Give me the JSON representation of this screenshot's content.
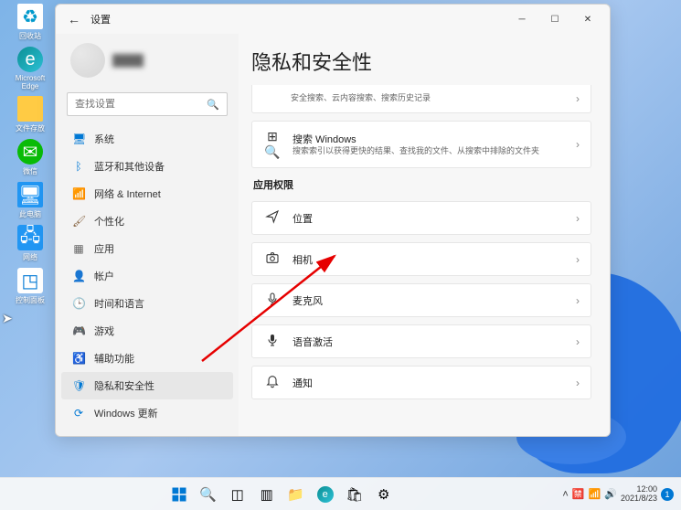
{
  "desktop": {
    "icons": [
      {
        "label": "回收站",
        "name": "recycle-bin"
      },
      {
        "label": "Microsoft Edge",
        "name": "edge"
      },
      {
        "label": "文件存放",
        "name": "folder-files"
      },
      {
        "label": "微信",
        "name": "wechat"
      },
      {
        "label": "此电脑",
        "name": "this-pc"
      },
      {
        "label": "网络",
        "name": "network"
      },
      {
        "label": "控制面板",
        "name": "control-panel"
      }
    ]
  },
  "window": {
    "title": "设置",
    "search_placeholder": "查找设置",
    "nav": [
      {
        "label": "系统",
        "icon": "🖥"
      },
      {
        "label": "蓝牙和其他设备",
        "icon": "ᛒ"
      },
      {
        "label": "网络 & Internet",
        "icon": "📶"
      },
      {
        "label": "个性化",
        "icon": "🖌"
      },
      {
        "label": "应用",
        "icon": "▦"
      },
      {
        "label": "帐户",
        "icon": "👤"
      },
      {
        "label": "时间和语言",
        "icon": "🕒"
      },
      {
        "label": "游戏",
        "icon": "🎮"
      },
      {
        "label": "辅助功能",
        "icon": "♿"
      },
      {
        "label": "隐私和安全性",
        "icon": "🛡"
      },
      {
        "label": "Windows 更新",
        "icon": "⟳"
      }
    ],
    "active_nav_index": 9,
    "page_title": "隐私和安全性",
    "top_partial": "安全搜索、云内容搜索、搜索历史记录",
    "search_card": {
      "title": "搜索 Windows",
      "sub": "搜索索引以获得更快的结果、查找我的文件、从搜索中排除的文件夹"
    },
    "section": "应用权限",
    "perms": [
      {
        "label": "位置",
        "icon": "send-icon"
      },
      {
        "label": "相机",
        "icon": "camera-icon"
      },
      {
        "label": "麦克风",
        "icon": "mic-icon"
      },
      {
        "label": "语音激活",
        "icon": "voice-icon"
      },
      {
        "label": "通知",
        "icon": "bell-icon"
      }
    ]
  },
  "taskbar": {
    "time": "12:00",
    "date": "2021/8/23",
    "notif_count": "1"
  }
}
